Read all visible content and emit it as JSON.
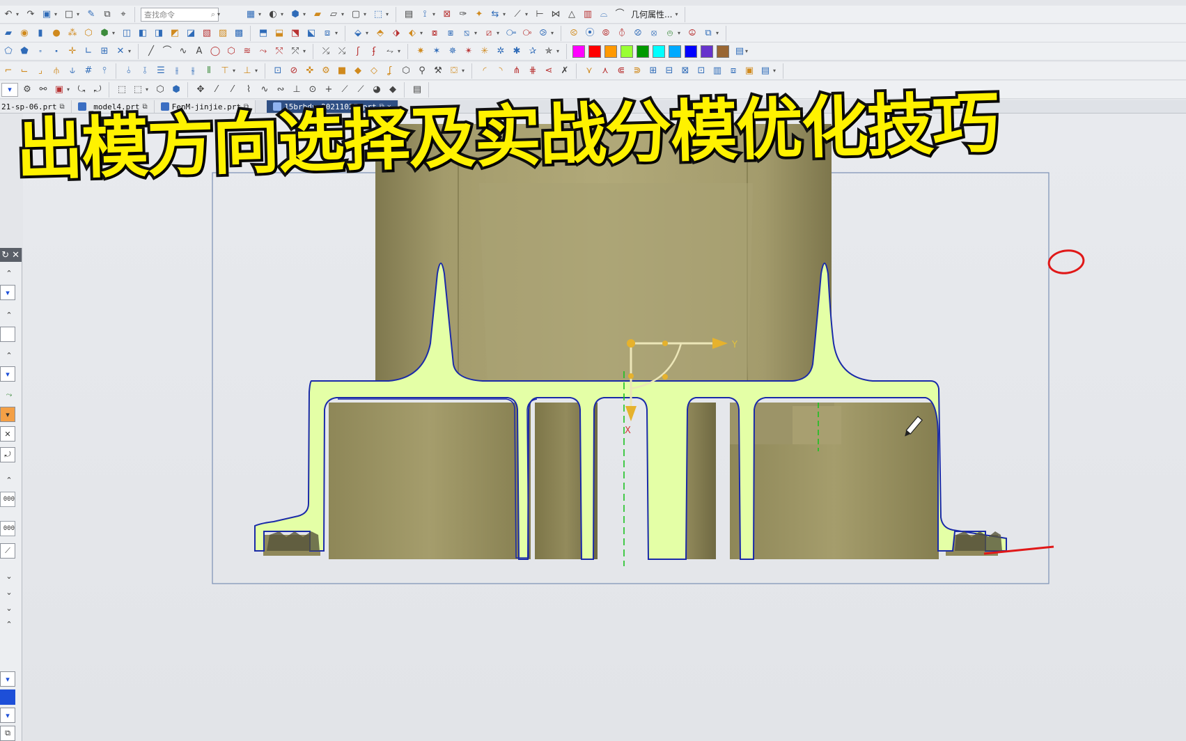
{
  "toolbar": {
    "search_placeholder": "查找命令",
    "geometry_properties_label": "几何属性...",
    "color_swatches": [
      "#ff00ff",
      "#ff0000",
      "#ff9900",
      "#99ff33",
      "#009900",
      "#00ffff",
      "#00aaff",
      "#0000ff",
      "#6633cc",
      "#996633"
    ]
  },
  "tabs": [
    {
      "label": "21-sp-06.prt",
      "active": false
    },
    {
      "label": "_model4.prt",
      "active": false
    },
    {
      "label": "FenM-jinjie.prt",
      "active": false
    },
    {
      "label": "15brbdy-20211027.prt",
      "active": true
    }
  ],
  "left_panel": {
    "values": [
      "000",
      "000"
    ]
  },
  "viewport": {
    "axis_y_label": "Y",
    "axis_x_label": "X"
  },
  "overlay": {
    "title": "出模方向选择及实战分模优化技巧"
  },
  "colors": {
    "section_fill": "#e4ffa6",
    "section_outline": "#1a2aa8",
    "body_color": "#a29a6a",
    "title_color": "#fff200",
    "annotation_red": "#e01818"
  }
}
